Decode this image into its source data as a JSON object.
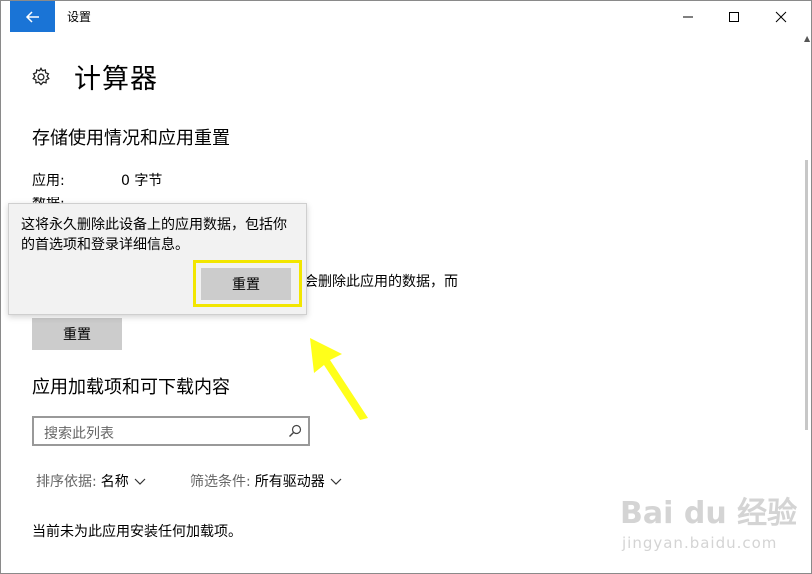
{
  "window": {
    "title": "设置",
    "accent": "#1a74d6"
  },
  "page": {
    "title": "计算器"
  },
  "storage": {
    "section_title": "存储使用情况和应用重置",
    "app_label": "应用:",
    "app_value": "0 字节",
    "data_label_partial": "数据:",
    "reset_description_partial": "会删除此应用的数据，而",
    "reset_button": "重置"
  },
  "popup": {
    "message": "这将永久删除此设备上的应用数据，包括你的首选项和登录详细信息。",
    "reset_button": "重置",
    "highlight_color": "#f2e600"
  },
  "addons": {
    "section_title": "应用加载项和可下载内容",
    "search_placeholder": "搜索此列表",
    "sort_label": "排序依据:",
    "sort_value": "名称",
    "filter_label": "筛选条件:",
    "filter_value": "所有驱动器",
    "empty_message": "当前未为此应用安装任何加载项。"
  },
  "annotation": {
    "arrow_color": "#ffff1a"
  },
  "watermark": {
    "brand": "Bai du 经验",
    "url": "jingyan.baidu.com"
  }
}
